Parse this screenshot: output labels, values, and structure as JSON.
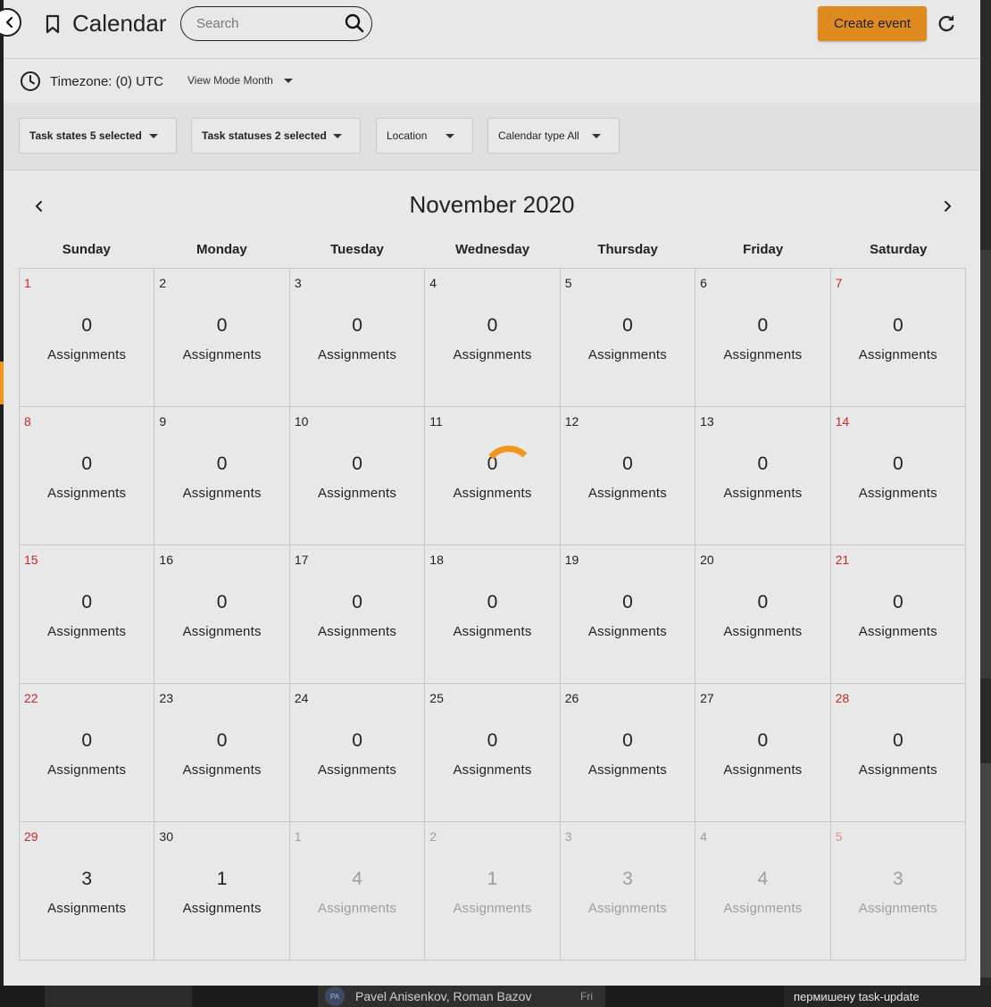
{
  "header": {
    "title": "Calendar",
    "search_placeholder": "Search",
    "create_label": "Create event"
  },
  "toolbar": {
    "timezone": "Timezone: (0) UTC",
    "view_mode": "View Mode Month"
  },
  "filters": [
    {
      "label": "Task states 5 selected"
    },
    {
      "label": "Task statuses 2 selected"
    },
    {
      "label": "Location"
    },
    {
      "label": "Calendar type All"
    }
  ],
  "calendar": {
    "month_title": "November 2020",
    "weekdays": [
      "Sunday",
      "Monday",
      "Tuesday",
      "Wednesday",
      "Thursday",
      "Friday",
      "Saturday"
    ],
    "assignments_label": "Assignments",
    "loading_day": "11",
    "days": [
      {
        "day": "1",
        "count": "0",
        "current": true
      },
      {
        "day": "2",
        "count": "0",
        "current": true
      },
      {
        "day": "3",
        "count": "0",
        "current": true
      },
      {
        "day": "4",
        "count": "0",
        "current": true
      },
      {
        "day": "5",
        "count": "0",
        "current": true
      },
      {
        "day": "6",
        "count": "0",
        "current": true
      },
      {
        "day": "7",
        "count": "0",
        "current": true
      },
      {
        "day": "8",
        "count": "0",
        "current": true
      },
      {
        "day": "9",
        "count": "0",
        "current": true
      },
      {
        "day": "10",
        "count": "0",
        "current": true
      },
      {
        "day": "11",
        "count": "0",
        "current": true
      },
      {
        "day": "12",
        "count": "0",
        "current": true
      },
      {
        "day": "13",
        "count": "0",
        "current": true
      },
      {
        "day": "14",
        "count": "0",
        "current": true
      },
      {
        "day": "15",
        "count": "0",
        "current": true
      },
      {
        "day": "16",
        "count": "0",
        "current": true
      },
      {
        "day": "17",
        "count": "0",
        "current": true
      },
      {
        "day": "18",
        "count": "0",
        "current": true
      },
      {
        "day": "19",
        "count": "0",
        "current": true
      },
      {
        "day": "20",
        "count": "0",
        "current": true
      },
      {
        "day": "21",
        "count": "0",
        "current": true
      },
      {
        "day": "22",
        "count": "0",
        "current": true
      },
      {
        "day": "23",
        "count": "0",
        "current": true
      },
      {
        "day": "24",
        "count": "0",
        "current": true
      },
      {
        "day": "25",
        "count": "0",
        "current": true
      },
      {
        "day": "26",
        "count": "0",
        "current": true
      },
      {
        "day": "27",
        "count": "0",
        "current": true
      },
      {
        "day": "28",
        "count": "0",
        "current": true
      },
      {
        "day": "29",
        "count": "3",
        "current": true
      },
      {
        "day": "30",
        "count": "1",
        "current": true
      },
      {
        "day": "1",
        "count": "4",
        "current": false
      },
      {
        "day": "2",
        "count": "1",
        "current": false
      },
      {
        "day": "3",
        "count": "3",
        "current": false
      },
      {
        "day": "4",
        "count": "4",
        "current": false
      },
      {
        "day": "5",
        "count": "3",
        "current": false
      }
    ]
  },
  "background": {
    "notification_avatar": "PA",
    "notification_sender": "Pavel Anisenkov, Roman Bazov",
    "notification_day": "Fri",
    "task_message": "пермишену task-update"
  },
  "colors": {
    "accent": "#df8a1f",
    "spinner": "#f0961e",
    "weekend_day": "#c62828"
  }
}
